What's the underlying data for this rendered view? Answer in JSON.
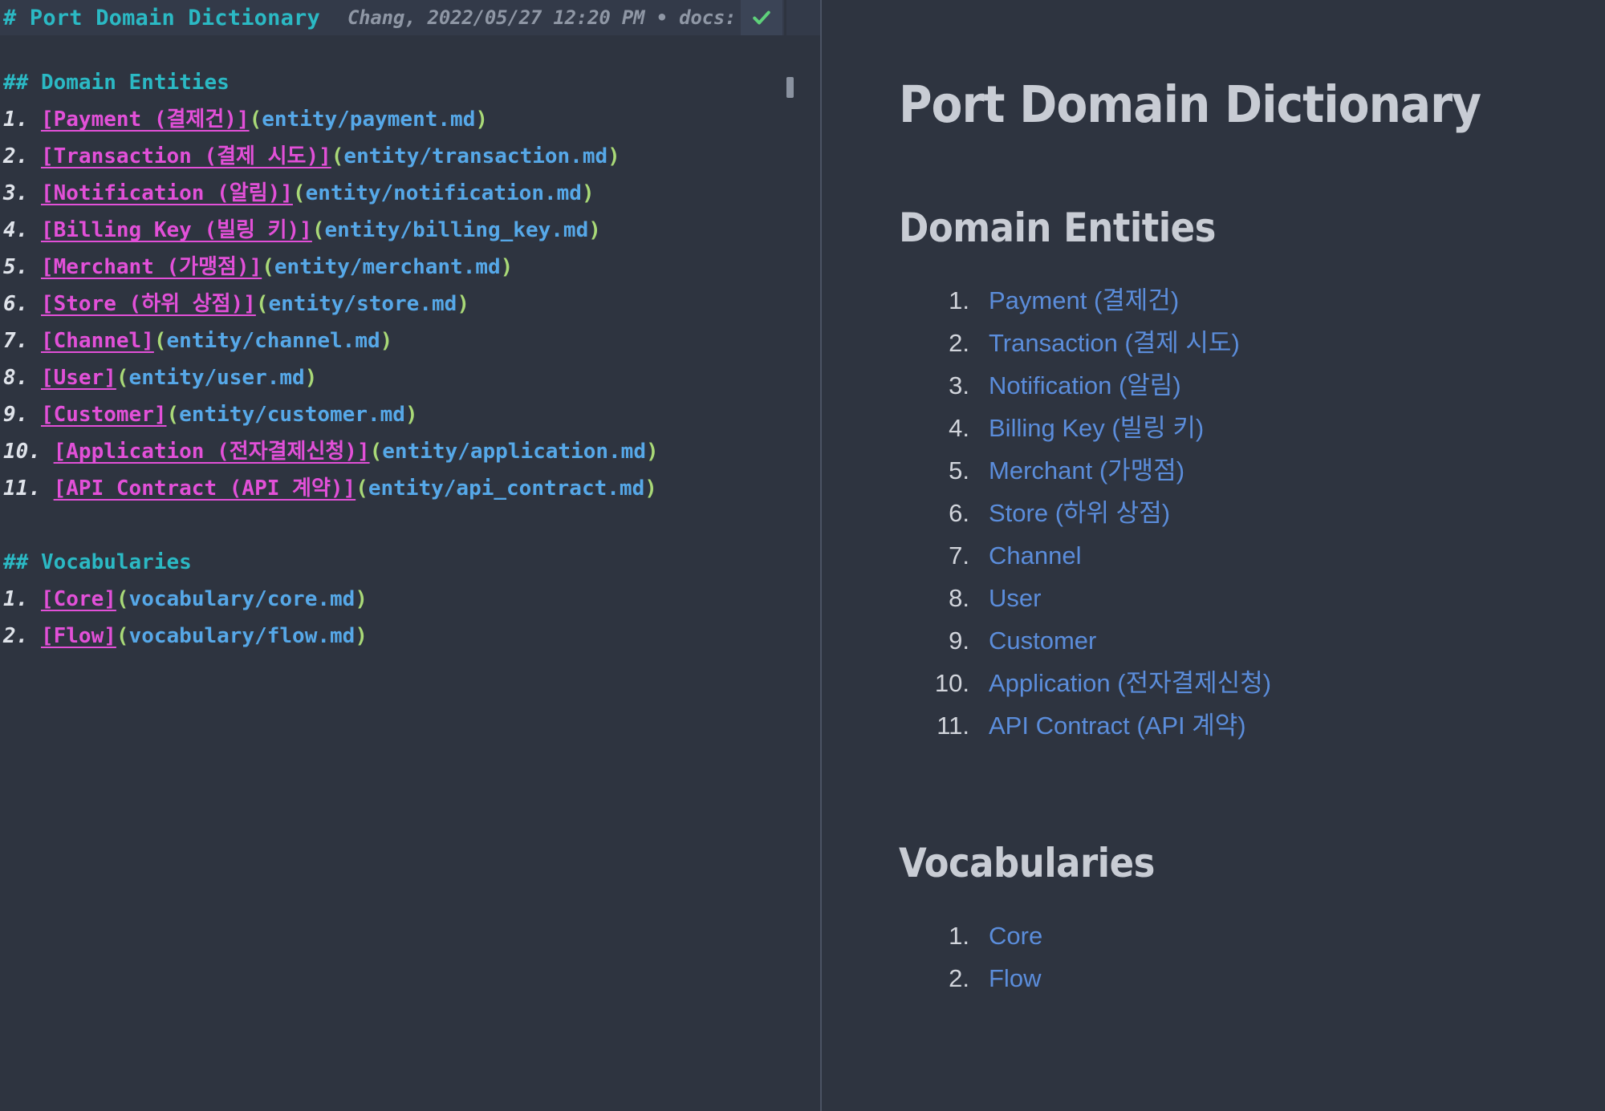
{
  "editor": {
    "header": {
      "title": "# Port Domain Dictionary",
      "meta": "Chang, 2022/05/27 12:20 PM • docs:",
      "sync_icon": "check-icon",
      "sync_color": "#5ed17a"
    },
    "lines": [
      {
        "type": "heading",
        "text": "## Domain Entities"
      },
      {
        "type": "link",
        "num": "1.",
        "text": "[Payment (결제건)]",
        "url": "(entity/payment.md)"
      },
      {
        "type": "link",
        "num": "2.",
        "text": "[Transaction (결제 시도)]",
        "url": "(entity/transaction.md)"
      },
      {
        "type": "link",
        "num": "3.",
        "text": "[Notification (알림)]",
        "url": "(entity/notification.md)"
      },
      {
        "type": "link",
        "num": "4.",
        "text": "[Billing Key (빌링 키)]",
        "url": "(entity/billing_key.md)"
      },
      {
        "type": "link",
        "num": "5.",
        "text": "[Merchant (가맹점)]",
        "url": "(entity/merchant.md)"
      },
      {
        "type": "link",
        "num": "6.",
        "text": "[Store (하위 상점)]",
        "url": "(entity/store.md)"
      },
      {
        "type": "link",
        "num": "7.",
        "text": "[Channel]",
        "url": "(entity/channel.md)"
      },
      {
        "type": "link",
        "num": "8.",
        "text": "[User]",
        "url": "(entity/user.md)"
      },
      {
        "type": "link",
        "num": "9.",
        "text": "[Customer]",
        "url": "(entity/customer.md)"
      },
      {
        "type": "link",
        "num": "10.",
        "text": "[Application (전자결제신청)]",
        "url": "(entity/application.md)"
      },
      {
        "type": "link",
        "num": "11.",
        "text": "[API Contract (API 계약)]",
        "url": "(entity/api_contract.md)"
      },
      {
        "type": "blank",
        "text": ""
      },
      {
        "type": "heading",
        "text": "## Vocabularies"
      },
      {
        "type": "link",
        "num": "1.",
        "text": "[Core]",
        "url": "(vocabulary/core.md)"
      },
      {
        "type": "link",
        "num": "2.",
        "text": "[Flow]",
        "url": "(vocabulary/flow.md)"
      }
    ],
    "colors": {
      "background": "#2e3440",
      "header_background": "#333a49",
      "heading": "#2bb9c4",
      "list_number": "#dfe3ea",
      "link_text": "#e250d8",
      "paren": "#a9d977",
      "url": "#56a8e8"
    }
  },
  "preview": {
    "title": "Port Domain Dictionary",
    "sections": [
      {
        "heading": "Domain Entities",
        "items": [
          "Payment (결제건)",
          "Transaction (결제 시도)",
          "Notification (알림)",
          "Billing Key (빌링 키)",
          "Merchant (가맹점)",
          "Store (하위 상점)",
          "Channel",
          "User",
          "Customer",
          "Application (전자결제신청)",
          "API Contract (API 계약)"
        ]
      },
      {
        "heading": "Vocabularies",
        "items": [
          "Core",
          "Flow"
        ]
      }
    ],
    "colors": {
      "background": "#2e3440",
      "heading": "#c8ccd4",
      "link": "#5b8ddb",
      "marker": "#d2d5dc"
    }
  }
}
